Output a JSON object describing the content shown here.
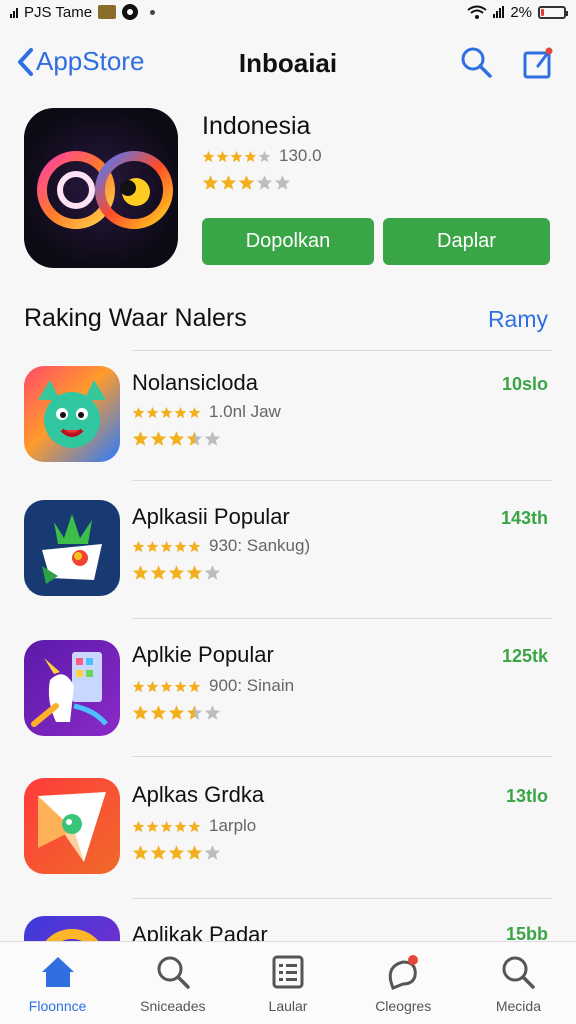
{
  "status_bar": {
    "carrier": "PJS Tame",
    "battery_text": "2%",
    "battery_level": 0.12
  },
  "nav": {
    "back_label": "AppStore",
    "title": "Inboaiai"
  },
  "featured": {
    "title": "Indonesia",
    "rating_count": "130.0",
    "stars_primary": 4,
    "stars_secondary": 3,
    "button_1": "Dopolkan",
    "button_2": "Daplar"
  },
  "section": {
    "title": "Raking Waar Nalers",
    "link": "Ramy"
  },
  "list": [
    {
      "name": "Nolansicloda",
      "meta": "1.0nl Jaw",
      "size": "10slo",
      "stars": 5,
      "stars_secondary": 3.5
    },
    {
      "name": "Aplkasii Popular",
      "meta": "930: Sankug)",
      "size": "143th",
      "stars": 5,
      "stars_secondary": 4
    },
    {
      "name": "Aplkie Popular",
      "meta": "900: Sinain",
      "size": "125tk",
      "stars": 5,
      "stars_secondary": 3.5
    },
    {
      "name": "Aplkas Grdka",
      "meta": "1arplo",
      "size": "13tlo",
      "stars": 5,
      "stars_secondary": 4
    },
    {
      "name": "Aplikak Padar",
      "meta": "",
      "size": "15bb",
      "stars": 0,
      "stars_secondary": 0
    }
  ],
  "tabs": [
    {
      "label": "Floonnce",
      "icon": "home-icon",
      "active": true
    },
    {
      "label": "Sniceades",
      "icon": "search-icon",
      "active": false
    },
    {
      "label": "Laular",
      "icon": "list-icon",
      "active": false
    },
    {
      "label": "Cleogres",
      "icon": "chat-icon",
      "active": false
    },
    {
      "label": "Mecida",
      "icon": "search-icon",
      "active": false
    }
  ],
  "colors": {
    "accent": "#2f6fe0",
    "green": "#3aa547",
    "star": "#f2b01e"
  }
}
